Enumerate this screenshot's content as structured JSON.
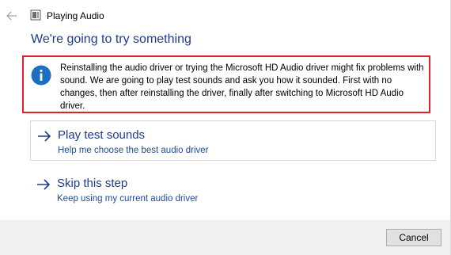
{
  "window": {
    "title": "Playing Audio",
    "heading": "We're going to try something"
  },
  "info": {
    "icon": "info-icon",
    "text": "Reinstalling the audio driver or trying the Microsoft HD Audio driver might fix problems with sound. We are going to play test sounds and ask you how it sounded. First with no changes, then after reinstalling the driver, finally after switching to Microsoft HD Audio driver."
  },
  "options": [
    {
      "title": "Play test sounds",
      "subtitle": "Help me choose the best audio driver",
      "icon": "arrow-right-icon"
    },
    {
      "title": "Skip this step",
      "subtitle": "Keep using my current audio driver",
      "icon": "arrow-right-icon"
    }
  ],
  "footer": {
    "cancel_label": "Cancel"
  },
  "colors": {
    "heading": "#1e3c8c",
    "highlight_border": "#e0202a",
    "info_icon": "#1b6ec2",
    "footer_bg": "#f0f0f0"
  }
}
